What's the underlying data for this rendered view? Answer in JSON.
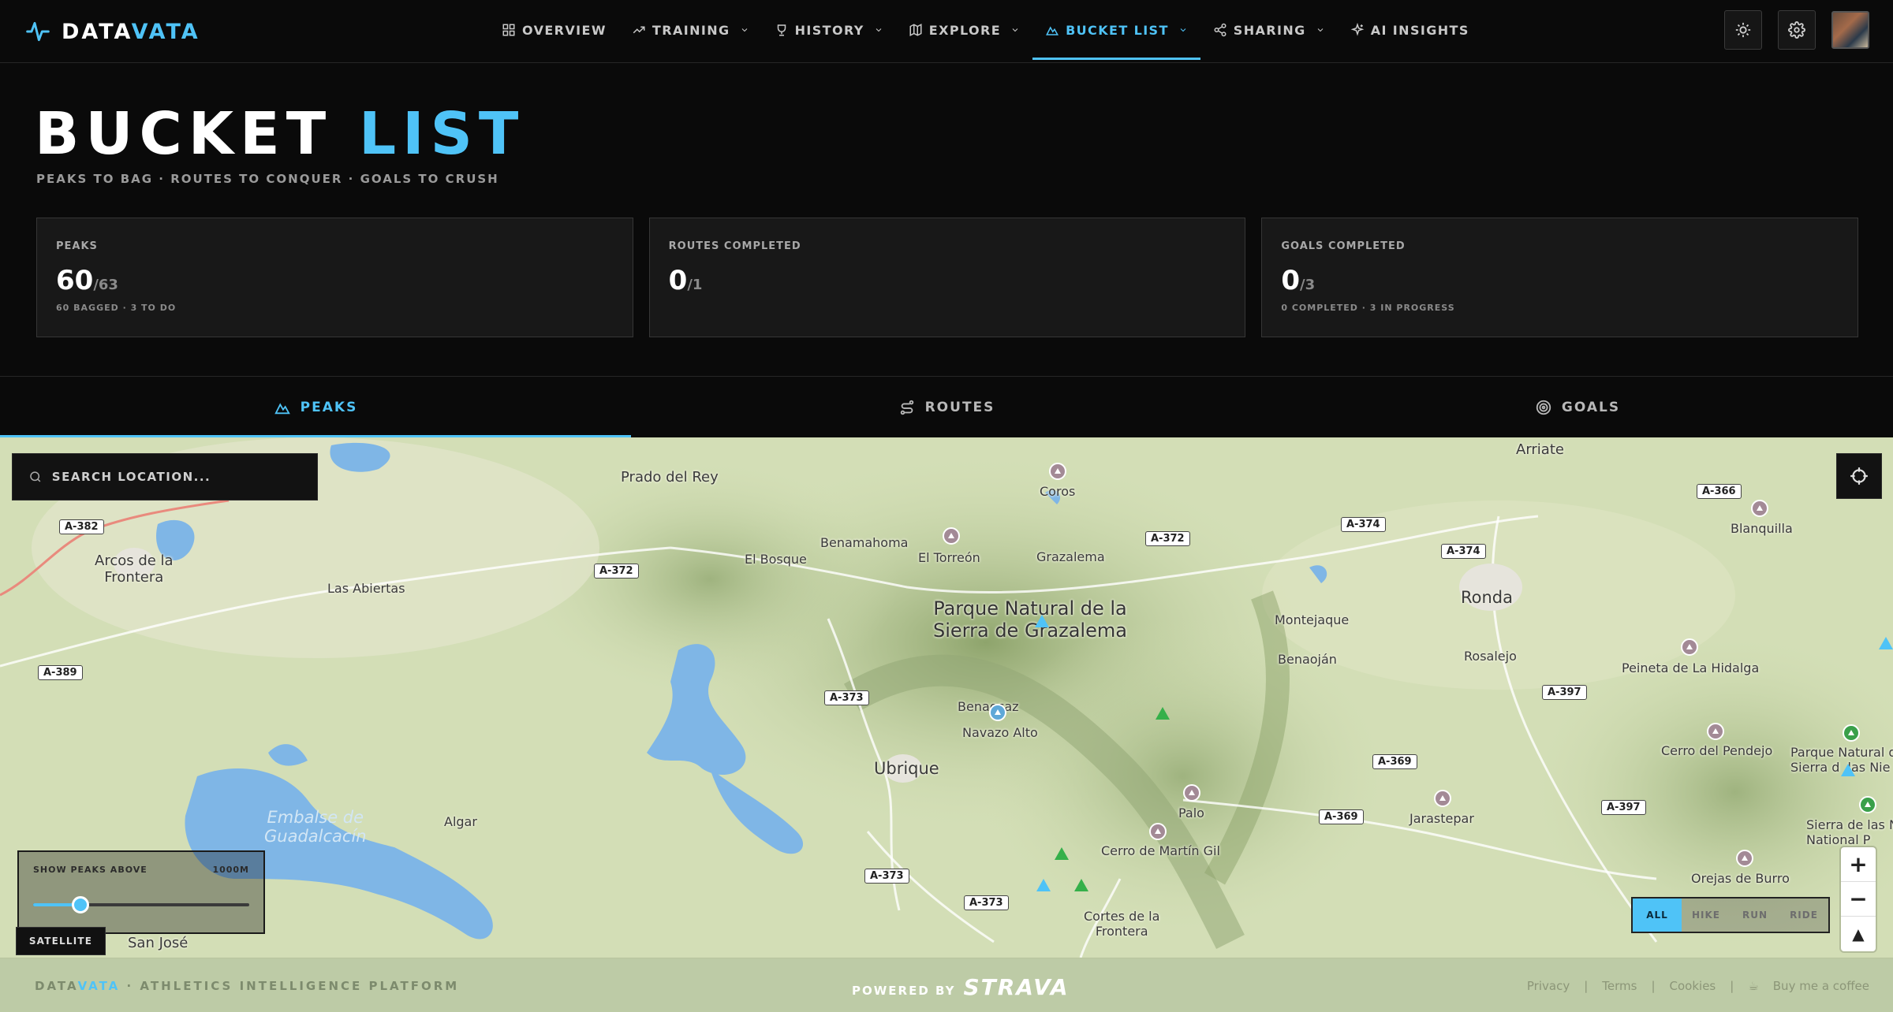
{
  "brand": {
    "name_a": "DATA",
    "name_b": "VATA"
  },
  "nav": {
    "items": [
      {
        "label": "OVERVIEW",
        "icon": "grid-icon",
        "dropdown": false
      },
      {
        "label": "TRAINING",
        "icon": "trending-up-icon",
        "dropdown": true
      },
      {
        "label": "HISTORY",
        "icon": "trophy-icon",
        "dropdown": true
      },
      {
        "label": "EXPLORE",
        "icon": "map-icon",
        "dropdown": true
      },
      {
        "label": "BUCKET LIST",
        "icon": "mountain-icon",
        "dropdown": true,
        "active": true
      },
      {
        "label": "SHARING",
        "icon": "share-icon",
        "dropdown": true
      },
      {
        "label": "AI INSIGHTS",
        "icon": "sparkles-icon",
        "dropdown": false
      }
    ]
  },
  "page": {
    "title_a": "BUCKET",
    "title_b": "LIST",
    "subtitle": "PEAKS TO BAG · ROUTES TO CONQUER · GOALS TO CRUSH"
  },
  "stats": [
    {
      "label": "PEAKS",
      "value": "60",
      "denom": "/63",
      "note": "60 BAGGED · 3 TO DO"
    },
    {
      "label": "ROUTES COMPLETED",
      "value": "0",
      "denom": "/1",
      "note": ""
    },
    {
      "label": "GOALS COMPLETED",
      "value": "0",
      "denom": "/3",
      "note": "0 COMPLETED · 3 IN PROGRESS"
    }
  ],
  "tabs": [
    {
      "label": "PEAKS",
      "icon": "mountain-icon",
      "active": true
    },
    {
      "label": "ROUTES",
      "icon": "route-icon",
      "active": false
    },
    {
      "label": "GOALS",
      "icon": "target-icon",
      "active": false
    }
  ],
  "map": {
    "search_placeholder": "SEARCH LOCATION...",
    "places": {
      "prado_del_rey": "Prado del Rey",
      "coros": "Coros",
      "arriate": "Arriate",
      "arcos": "Arcos de la\nFrontera",
      "el_bosque": "El Bosque",
      "benamahoma": "Benamahoma",
      "el_torreon": "El Torreón",
      "grazalema": "Grazalema",
      "blanquilla": "Blanquilla",
      "las_abiertas": "Las Abiertas",
      "parque_grazalema": "Parque Natural de la\nSierra de Grazalema",
      "ronda": "Ronda",
      "montejaque": "Montejaque",
      "benaojan": "Benaoján",
      "rosalejo": "Rosalejo",
      "peineta": "Peineta de La Hidalga",
      "benaocaz": "Benaocaz",
      "navazo_alto": "Navazo Alto",
      "ubrique": "Ubrique",
      "cerro_pendejo": "Cerro del Pendejo",
      "parque_nieves": "Parque Natural d\nSierra d  las Nie",
      "embalse": "Embalse de\nGuadalcacín",
      "algar": "Algar",
      "palo": "Palo",
      "jarastepar": "Jarastepar",
      "sierra_nieves": "Sierra de las N\nNational P",
      "cerro_martin_gil": "Cerro de Martín Gil",
      "orejas_burro": "Orejas de Burro",
      "cortes": "Cortes de la\nFrontera",
      "san_jose": "San José"
    },
    "roads": {
      "a382": "A-382",
      "a372a": "A-372",
      "a372b": "A-372",
      "a374a": "A-374",
      "a374b": "A-374",
      "a366": "A-366",
      "a389": "A-389",
      "a373a": "A-373",
      "a397a": "A-397",
      "a369a": "A-369",
      "a369b": "A-369",
      "a397b": "A-397",
      "a373b": "A-373",
      "a373c": "A-373"
    },
    "filter": {
      "label": "SHOW PEAKS ABOVE",
      "value": "1000M",
      "level_fraction": 0.22
    },
    "satellite_label": "SATELLITE",
    "activity_filter": [
      "ALL",
      "HIKE",
      "RUN",
      "RIDE"
    ],
    "zoom": {
      "in": "+",
      "out": "−",
      "compass": "▲"
    }
  },
  "footer": {
    "brand_a": "DATA",
    "brand_b": "VATA",
    "tagline": " · ATHLETICS INTELLIGENCE PLATFORM",
    "powered_by": "POWERED BY",
    "strava": "STRAVA",
    "links": [
      "Privacy",
      "Terms",
      "Cookies",
      "Buy me a coffee"
    ]
  },
  "colors": {
    "accent": "#4fc3f7",
    "background": "#0a0a0a",
    "card": "#181818"
  }
}
